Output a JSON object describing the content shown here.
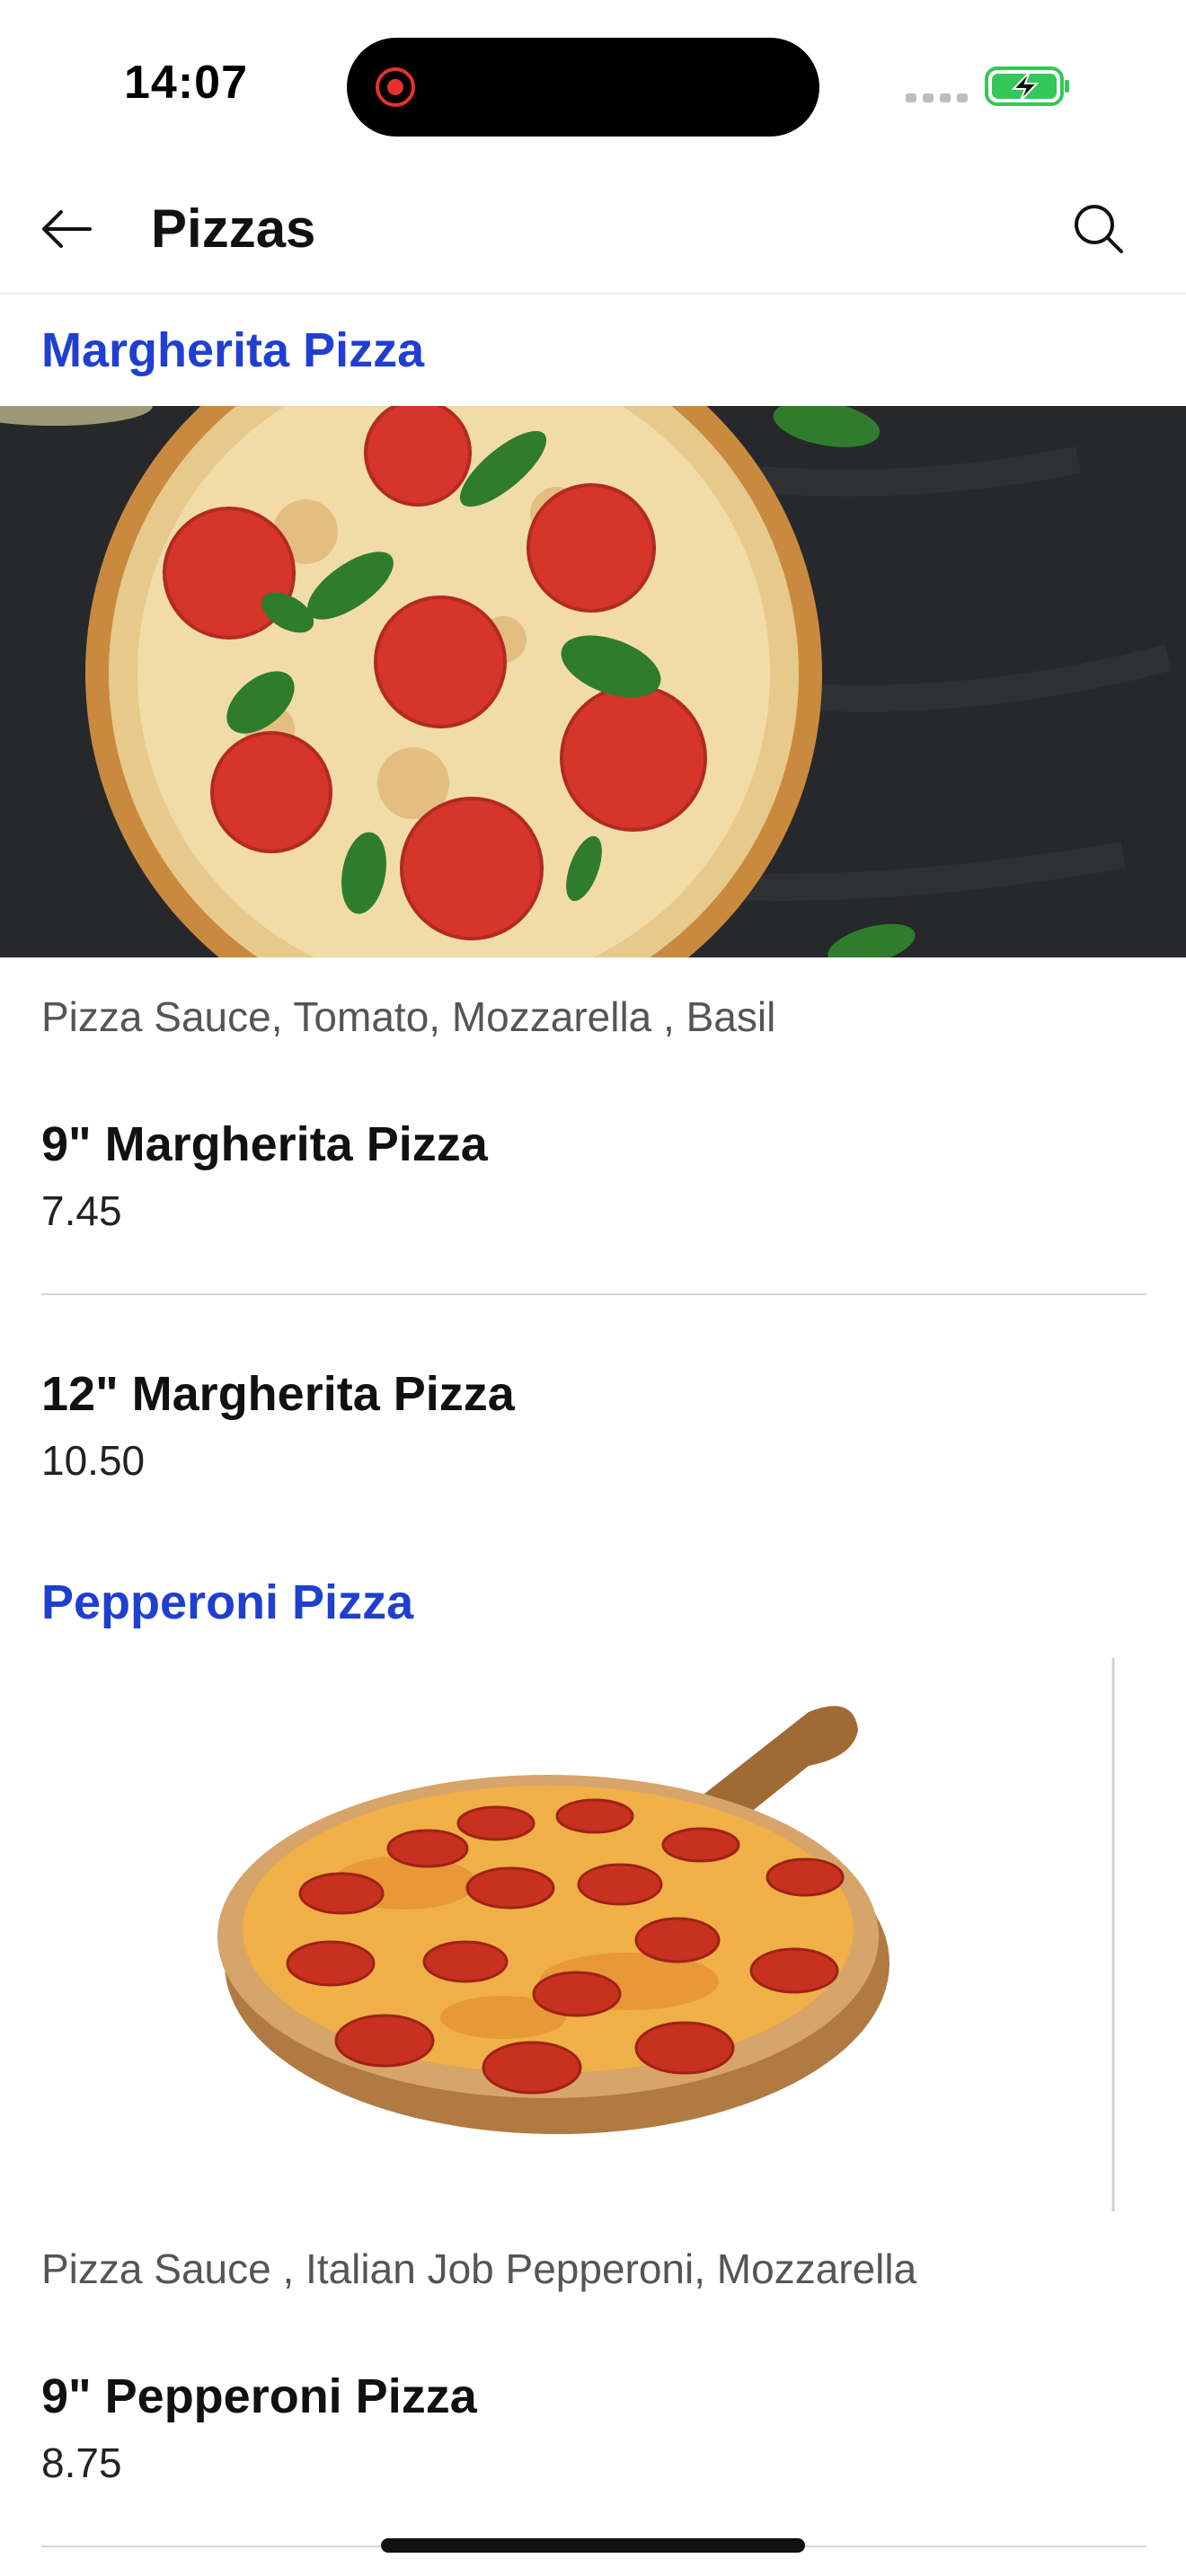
{
  "status": {
    "time": "14:07",
    "recording_color": "#e5322d",
    "battery_color": "#34c759"
  },
  "header": {
    "title": "Pizzas",
    "back_icon": "arrow-left-icon",
    "search_icon": "search-icon"
  },
  "accent_color": "#1f3fd0",
  "sections": [
    {
      "title": "Margherita Pizza",
      "image": "margherita-pizza-photo",
      "description": "Pizza Sauce, Tomato, Mozzarella , Basil",
      "items": [
        {
          "name": "9\" Margherita Pizza",
          "price": "7.45"
        },
        {
          "name": "12\" Margherita Pizza",
          "price": "10.50"
        }
      ]
    },
    {
      "title": "Pepperoni Pizza",
      "image": "pepperoni-pizza-photo",
      "description": "Pizza Sauce , Italian Job Pepperoni, Mozzarella",
      "items": [
        {
          "name": "9\" Pepperoni Pizza",
          "price": "8.75"
        }
      ]
    }
  ]
}
